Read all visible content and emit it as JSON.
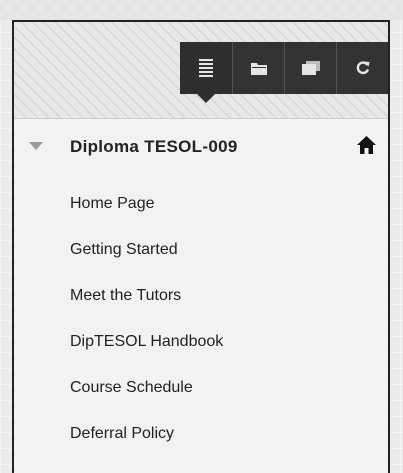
{
  "toolbar": {
    "buttons": [
      {
        "icon": "list-view-icon",
        "active": true
      },
      {
        "icon": "folder-icon",
        "active": false
      },
      {
        "icon": "window-icon",
        "active": false
      },
      {
        "icon": "refresh-icon",
        "active": false
      }
    ]
  },
  "course": {
    "title": "Diploma TESOL-009",
    "home_icon": "home-icon"
  },
  "menu": {
    "items": [
      {
        "label": "Home Page"
      },
      {
        "label": "Getting Started"
      },
      {
        "label": "Meet the Tutors"
      },
      {
        "label": "DipTESOL Handbook"
      },
      {
        "label": "Course Schedule"
      },
      {
        "label": "Deferral Policy"
      }
    ]
  },
  "colors": {
    "toolbar_button_bg": "#333333",
    "panel_bg": "#f2f2f2",
    "text": "#222222"
  }
}
